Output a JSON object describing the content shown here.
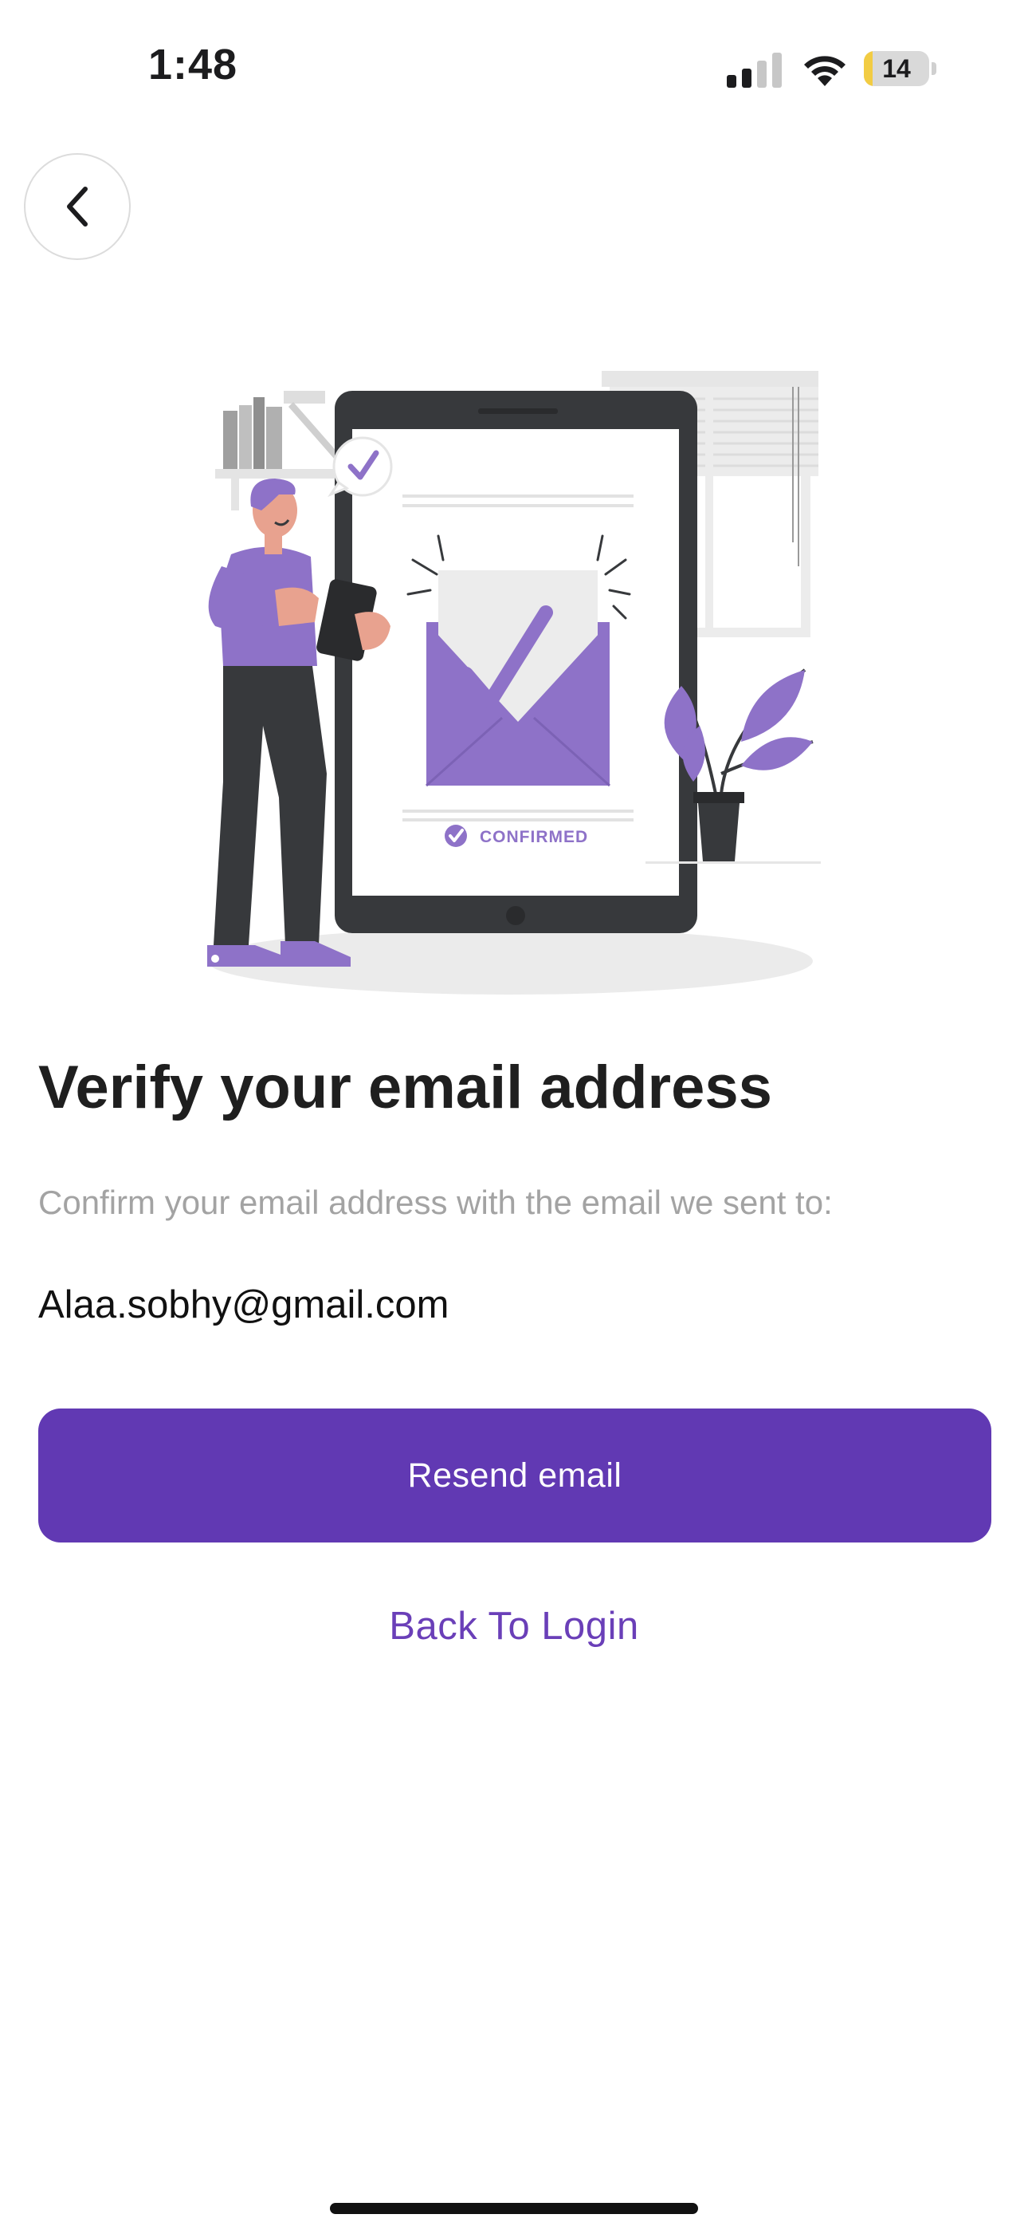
{
  "status_bar": {
    "time": "1:48",
    "battery_level": "14",
    "battery_fraction": 0.14,
    "battery_color": "#f2cc43",
    "signal_icon": "cellular-signal-icon",
    "wifi_icon": "wifi-icon"
  },
  "nav": {
    "back_icon": "chevron-left-icon"
  },
  "illustration": {
    "badge_text": "CONFIRMED"
  },
  "content": {
    "title": "Verify your email address",
    "subtitle": "Confirm your email address with the email we sent to:",
    "email": "Alaa.sobhy@gmail.com"
  },
  "actions": {
    "resend_label": "Resend email",
    "back_to_login_label": "Back To Login"
  },
  "colors": {
    "accent": "#6139b3",
    "illustration_purple": "#8e72c8",
    "dark": "#37393c",
    "subtitle_gray": "#a3a3a3"
  }
}
